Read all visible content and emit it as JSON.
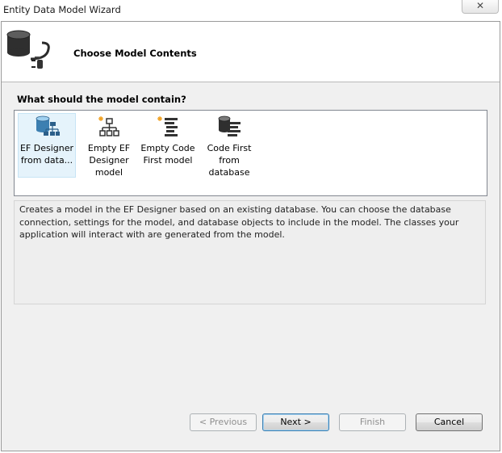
{
  "window": {
    "title": "Entity Data Model Wizard",
    "close_glyph": "✕"
  },
  "header": {
    "title": "Choose Model Contents",
    "icon": "database-plug-icon"
  },
  "model_section": {
    "label": "What should the model contain?",
    "options": [
      {
        "label": "EF Designer from data...",
        "icon": "ef-designer-from-database-icon",
        "selected": true
      },
      {
        "label": "Empty EF Designer model",
        "icon": "empty-ef-designer-icon",
        "selected": false
      },
      {
        "label": "Empty Code First model",
        "icon": "empty-code-first-icon",
        "selected": false
      },
      {
        "label": "Code First from database",
        "icon": "code-first-from-database-icon",
        "selected": false
      }
    ]
  },
  "description": "Creates a model in the EF Designer based on an existing database. You can choose the database connection, settings for the model, and database objects to include in the model. The classes your application will interact with are generated from the model.",
  "buttons": {
    "previous": "< Previous",
    "next": "Next >",
    "finish": "Finish",
    "cancel": "Cancel"
  },
  "colors": {
    "accent_blue": "#3c7fb1",
    "sparkle_orange": "#f0a020",
    "selection_bg": "#e5f3fb"
  }
}
